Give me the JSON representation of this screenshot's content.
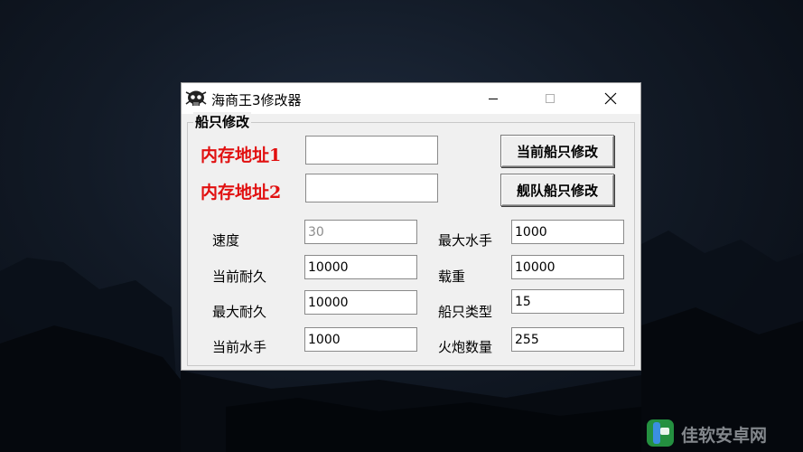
{
  "window": {
    "title": "海商王3修改器",
    "controls": {
      "minimize": "—",
      "maximize": "☐",
      "close": "✕"
    }
  },
  "group": {
    "title": "船只修改",
    "address1": {
      "label": "内存地址1",
      "value": ""
    },
    "address2": {
      "label": "内存地址2",
      "value": ""
    },
    "buttons": {
      "current_ship": "当前船只修改",
      "fleet_ship": "舰队船只修改"
    },
    "fields": {
      "speed": {
        "label": "速度",
        "value": "30"
      },
      "current_durability": {
        "label": "当前耐久",
        "value": "10000"
      },
      "max_durability": {
        "label": "最大耐久",
        "value": "10000"
      },
      "current_sailors": {
        "label": "当前水手",
        "value": "1000"
      },
      "max_sailors": {
        "label": "最大水手",
        "value": "1000"
      },
      "cargo": {
        "label": "载重",
        "value": "10000"
      },
      "ship_type": {
        "label": "船只类型",
        "value": "15"
      },
      "cannons": {
        "label": "火炮数量",
        "value": "255"
      }
    }
  },
  "watermark": {
    "text": "佳软安卓网"
  }
}
